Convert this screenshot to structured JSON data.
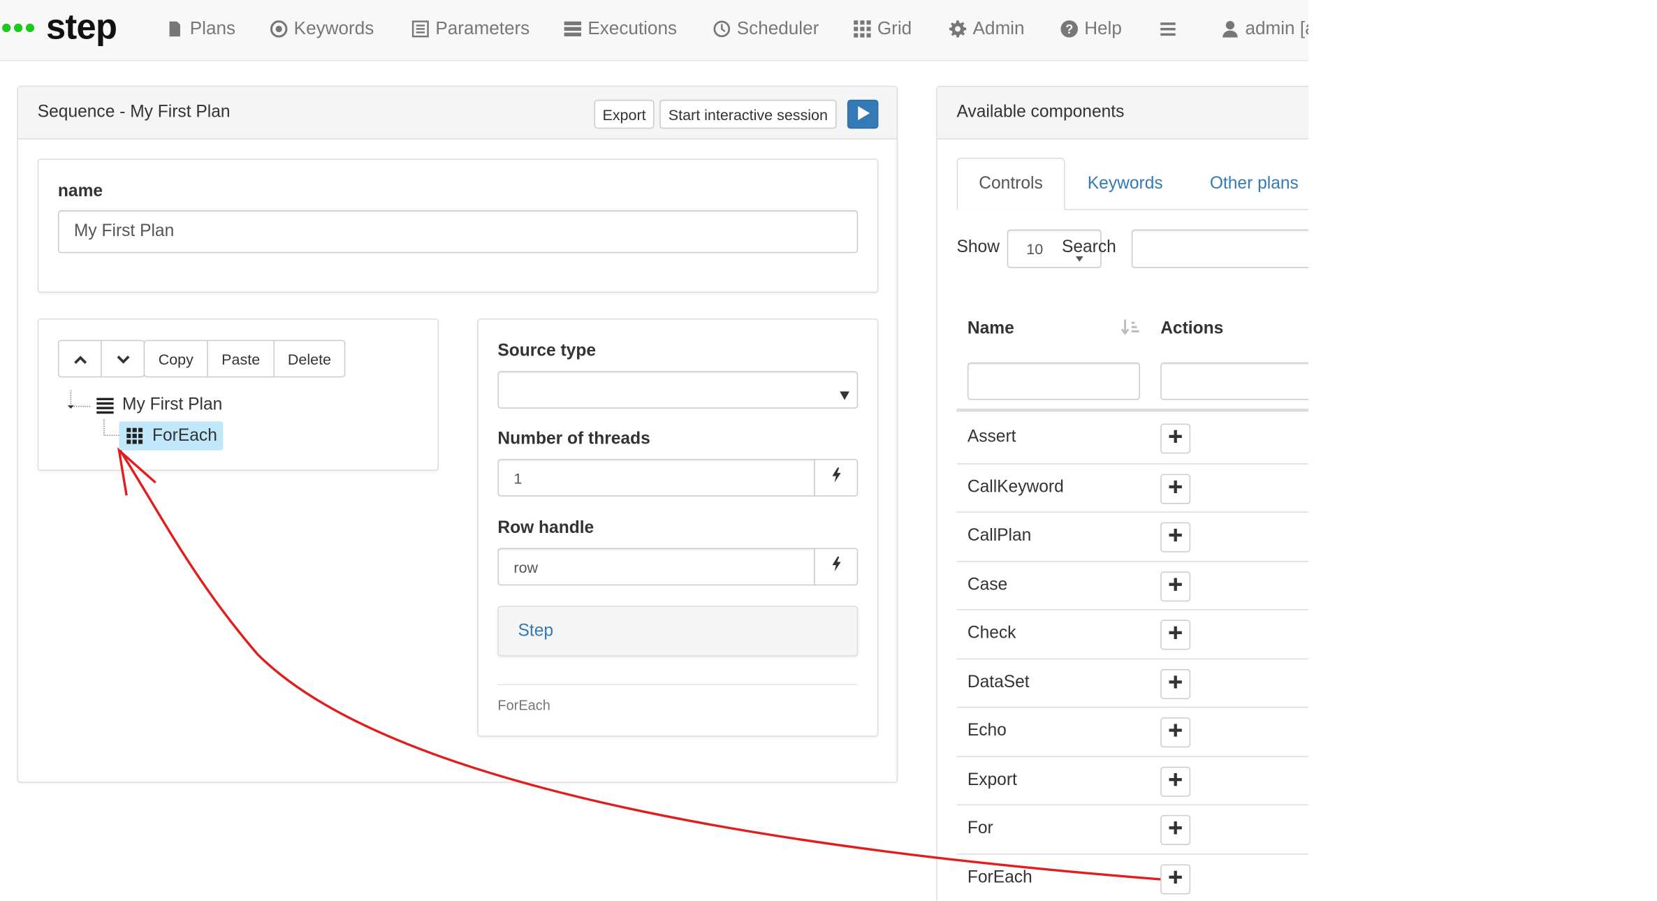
{
  "navbar": {
    "brand": "step",
    "items": [
      {
        "label": "Plans",
        "icon": "file-icon"
      },
      {
        "label": "Keywords",
        "icon": "target-icon"
      },
      {
        "label": "Parameters",
        "icon": "list-icon"
      },
      {
        "label": "Executions",
        "icon": "tasks-icon"
      },
      {
        "label": "Scheduler",
        "icon": "clock-icon"
      },
      {
        "label": "Grid",
        "icon": "grid-icon"
      },
      {
        "label": "Admin",
        "icon": "gear-icon"
      },
      {
        "label": "Help",
        "icon": "help-icon"
      }
    ],
    "user": "admin [a"
  },
  "plan_panel": {
    "title": "Sequence - My First Plan",
    "export_label": "Export",
    "interactive_label": "Start interactive session"
  },
  "name_section": {
    "label": "name",
    "value": "My First Plan"
  },
  "tree_toolbar": {
    "copy": "Copy",
    "paste": "Paste",
    "delete": "Delete"
  },
  "tree": {
    "root": "My First Plan",
    "child": "ForEach"
  },
  "foreach_form": {
    "source_type_label": "Source type",
    "source_type_value": "",
    "threads_label": "Number of threads",
    "threads_value": "1",
    "row_handle_label": "Row handle",
    "row_handle_value": "row",
    "step_label": "Step",
    "footer": "ForEach"
  },
  "components": {
    "title": "Available components",
    "tabs": [
      "Controls",
      "Keywords",
      "Other plans"
    ],
    "show_label": "Show",
    "page_size": "10",
    "search_label": "Search",
    "columns": {
      "name": "Name",
      "actions": "Actions"
    },
    "rows": [
      "Assert",
      "CallKeyword",
      "CallPlan",
      "Case",
      "Check",
      "DataSet",
      "Echo",
      "Export",
      "For",
      "ForEach"
    ]
  },
  "colors": {
    "accent": "#337ab7",
    "brand_dots": "#1ec81e",
    "selection": "#c1e7fb",
    "annotation_arrow": "#e01e1e"
  }
}
